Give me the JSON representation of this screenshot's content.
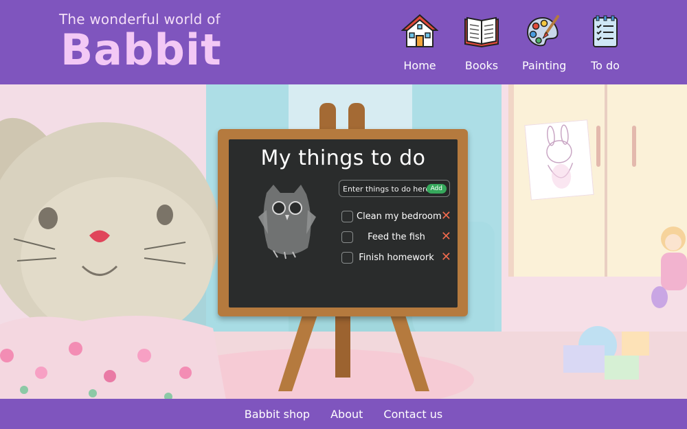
{
  "header": {
    "subtitle": "The wonderful world of",
    "title": "Babbit"
  },
  "nav": {
    "items": [
      {
        "label": "Home",
        "icon": "house-icon"
      },
      {
        "label": "Books",
        "icon": "book-icon"
      },
      {
        "label": "Painting",
        "icon": "palette-icon"
      },
      {
        "label": "To do",
        "icon": "checklist-icon"
      }
    ]
  },
  "todo": {
    "title": "My things to do",
    "input_placeholder": "Enter things to do here",
    "add_label": "Add",
    "delete_glyph": "✕",
    "items": [
      {
        "text": "Clean my bedroom",
        "checked": false
      },
      {
        "text": "Feed the fish",
        "checked": false
      },
      {
        "text": "Finish homework",
        "checked": false
      }
    ]
  },
  "footer": {
    "links": [
      "Babbit shop",
      "About",
      "Contact us"
    ]
  },
  "colors": {
    "brand_purple": "#7f55be",
    "title_pink": "#f3c8f5",
    "chalkboard": "#2a2c2c",
    "easel_wood": "#b57a3e",
    "add_green": "#36a85c",
    "delete_red": "#ee6a4d"
  }
}
